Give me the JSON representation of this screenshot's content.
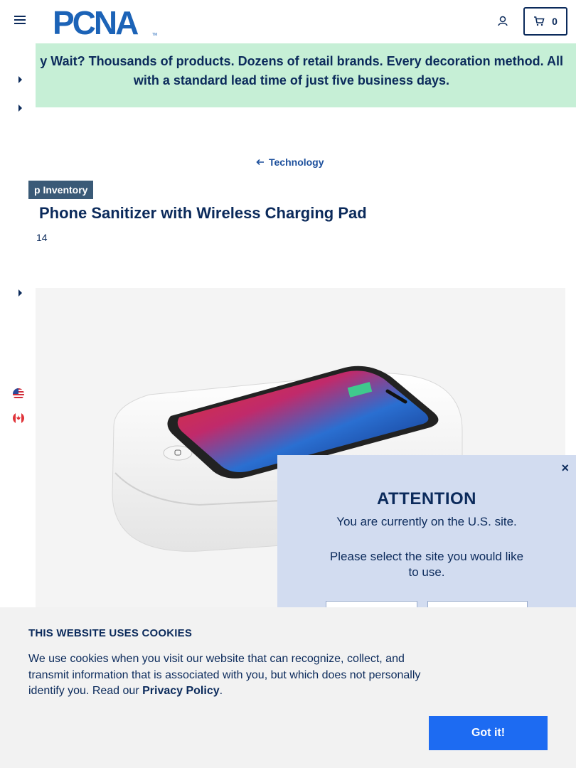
{
  "header": {
    "logo_text": "PCNA",
    "logo_tm": "TM",
    "cart_count": "0"
  },
  "banner": {
    "line1": "y Wait? Thousands of products. Dozens of retail brands. Every decoration method. All",
    "line2": "with a standard lead time of just five business days."
  },
  "breadcrumb": {
    "back_label": "Technology"
  },
  "product": {
    "badge": "p Inventory",
    "title": "Phone Sanitizer with Wireless Charging Pad",
    "sku": "14"
  },
  "modal": {
    "close": "×",
    "title": "ATTENTION",
    "message": "You are currently on the U.S. site.",
    "prompt": "Please select the site you would like to use."
  },
  "cookie": {
    "title": "THIS WEBSITE USES COOKIES",
    "body_prefix": "We use cookies when you visit our website that can recognize, collect, and transmit information that is associated with you, but which does not personally identify you. Read our ",
    "policy_link": "Privacy Policy",
    "body_suffix": ".",
    "button": "Got it!"
  },
  "colors": {
    "brand_navy": "#0b2a5b",
    "logo_blue": "#1c63b7",
    "banner_green": "#c6efd6",
    "badge_slate": "#3a5a77",
    "modal_bg": "#d2dcf0",
    "cookie_button": "#1d6bf2"
  },
  "icons": [
    "hamburger-icon",
    "account-icon",
    "cart-icon",
    "caret-right-icon",
    "us-flag-icon",
    "canada-flag-icon",
    "arrow-left-icon",
    "close-icon"
  ]
}
